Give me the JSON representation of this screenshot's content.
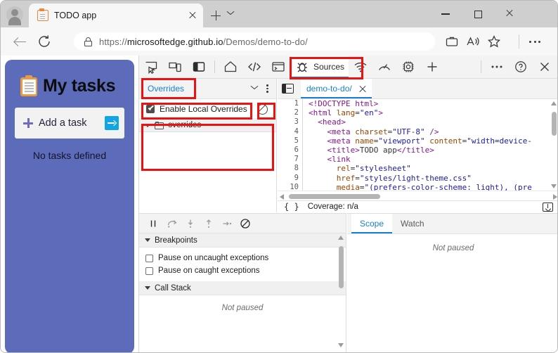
{
  "browser": {
    "tab": {
      "title": "TODO app",
      "favicon": "clipboard-icon"
    },
    "window_controls": {
      "minimize": "Minimize",
      "maximize": "Maximize",
      "close": "Close"
    },
    "new_tab": "New tab",
    "tab_list": "Tab actions menu",
    "nav": {
      "back": "Back",
      "reload": "Refresh"
    },
    "address": {
      "scheme": "https://",
      "host": "microsoftedge.github.io",
      "path": "/Demos/demo-to-do/",
      "lock": "site-information-lock-icon"
    },
    "toolbar_icons": {
      "collections": "collections-icon",
      "read_aloud": "read-aloud-icon",
      "favorites": "favorites-star-icon",
      "settings": "settings-and-more-icon"
    }
  },
  "page": {
    "title": "My tasks",
    "clipboard_emoji": "clipboard-icon",
    "add_task_placeholder": "Add a task",
    "submit_label": "submit-arrow-icon",
    "empty_state": "No tasks defined"
  },
  "devtools": {
    "toolbar_left": [
      {
        "name": "inspect-element-icon",
        "label": ""
      },
      {
        "name": "device-emulation-icon",
        "label": ""
      },
      {
        "name": "dock-side-icon",
        "label": ""
      }
    ],
    "tabs": [
      {
        "name": "welcome",
        "label": "",
        "icon": "home-icon",
        "selected": false
      },
      {
        "name": "elements",
        "label": "",
        "icon": "code-icon",
        "selected": false
      },
      {
        "name": "console",
        "label": "",
        "icon": "console-icon",
        "selected": false
      },
      {
        "name": "sources",
        "label": "Sources",
        "icon": "bug-icon",
        "selected": true
      },
      {
        "name": "network",
        "label": "",
        "icon": "wifi-icon",
        "selected": false
      },
      {
        "name": "performance",
        "label": "",
        "icon": "gauge-icon",
        "selected": false
      },
      {
        "name": "memory",
        "label": "",
        "icon": "chip-icon",
        "selected": false
      },
      {
        "name": "more-tools",
        "label": "",
        "icon": "plus-icon",
        "selected": false
      }
    ],
    "toolbar_right": [
      {
        "name": "customize-devtools",
        "icon": "kebab-icon"
      },
      {
        "name": "help",
        "icon": "question-mark-icon"
      },
      {
        "name": "close-devtools",
        "icon": "close-icon"
      }
    ],
    "navigator": {
      "tab_label": "Overrides",
      "more_tabs_icon": "chevron-down-icon",
      "kebab_icon": "kebab-icon",
      "enable_local_overrides": "Enable Local Overrides",
      "enable_checked": true,
      "clear_overrides_icon": "clear-configuration-icon",
      "tree_root": "overrides"
    },
    "editor": {
      "drawer_icon": "show-navigator-icon",
      "tab_label": "demo-to-do/",
      "close_icon": "close-icon",
      "code_lines": [
        {
          "n": 1,
          "tokens": [
            {
              "t": "tg",
              "s": "<!DOCTYPE html>"
            }
          ]
        },
        {
          "n": 2,
          "tokens": [
            {
              "t": "tg",
              "s": "<html "
            },
            {
              "t": "at",
              "s": "lang"
            },
            {
              "t": "pl",
              "s": "="
            },
            {
              "t": "va",
              "s": "\"en\""
            },
            {
              "t": "tg",
              "s": ">"
            }
          ]
        },
        {
          "n": 3,
          "tokens": [
            {
              "t": "pl",
              "s": "  "
            },
            {
              "t": "tg",
              "s": "<head>"
            }
          ]
        },
        {
          "n": 4,
          "tokens": [
            {
              "t": "pl",
              "s": "    "
            },
            {
              "t": "tg",
              "s": "<meta "
            },
            {
              "t": "at",
              "s": "charset"
            },
            {
              "t": "pl",
              "s": "="
            },
            {
              "t": "va",
              "s": "\"UTF-8\""
            },
            {
              "t": "tg",
              "s": " />"
            }
          ]
        },
        {
          "n": 5,
          "tokens": [
            {
              "t": "pl",
              "s": "    "
            },
            {
              "t": "tg",
              "s": "<meta "
            },
            {
              "t": "at",
              "s": "name"
            },
            {
              "t": "pl",
              "s": "="
            },
            {
              "t": "va",
              "s": "\"viewport\""
            },
            {
              "t": "at",
              "s": " content"
            },
            {
              "t": "pl",
              "s": "="
            },
            {
              "t": "va",
              "s": "\"width=device-"
            }
          ]
        },
        {
          "n": 6,
          "tokens": [
            {
              "t": "pl",
              "s": "    "
            },
            {
              "t": "tg",
              "s": "<title>"
            },
            {
              "t": "pl",
              "s": "TODO app"
            },
            {
              "t": "tg",
              "s": "</title>"
            }
          ]
        },
        {
          "n": 7,
          "tokens": [
            {
              "t": "pl",
              "s": "    "
            },
            {
              "t": "tg",
              "s": "<link"
            }
          ]
        },
        {
          "n": 8,
          "tokens": [
            {
              "t": "pl",
              "s": "      "
            },
            {
              "t": "at",
              "s": "rel"
            },
            {
              "t": "pl",
              "s": "="
            },
            {
              "t": "va",
              "s": "\"stylesheet\""
            }
          ]
        },
        {
          "n": 9,
          "tokens": [
            {
              "t": "pl",
              "s": "      "
            },
            {
              "t": "at",
              "s": "href"
            },
            {
              "t": "pl",
              "s": "="
            },
            {
              "t": "va",
              "s": "\"styles/light-theme.css\""
            }
          ]
        },
        {
          "n": 10,
          "tokens": [
            {
              "t": "pl",
              "s": "      "
            },
            {
              "t": "at",
              "s": "media"
            },
            {
              "t": "pl",
              "s": "="
            },
            {
              "t": "va",
              "s": "\"(prefers-color-scheme: light), (pre"
            }
          ]
        }
      ],
      "pretty_print": "{ }",
      "coverage": "Coverage: n/a",
      "export_icon": "export-icon"
    },
    "debugger": {
      "controls": [
        {
          "name": "pause-script-execution",
          "icon": "pause-icon"
        },
        {
          "name": "step-over",
          "icon": "step-over-icon"
        },
        {
          "name": "step-into",
          "icon": "step-into-icon"
        },
        {
          "name": "step-out",
          "icon": "step-out-icon"
        },
        {
          "name": "step",
          "icon": "step-icon"
        },
        {
          "name": "deactivate-breakpoints",
          "icon": "deactivate-breakpoints-icon"
        }
      ],
      "breakpoints_header": "Breakpoints",
      "breakpoint_options": [
        {
          "label": "Pause on uncaught exceptions",
          "checked": false
        },
        {
          "label": "Pause on caught exceptions",
          "checked": false
        }
      ],
      "call_stack_header": "Call Stack",
      "call_stack_empty": "Not paused"
    },
    "scope_panel": {
      "tabs": [
        {
          "label": "Scope",
          "selected": true
        },
        {
          "label": "Watch",
          "selected": false
        }
      ],
      "empty": "Not paused"
    }
  },
  "annotations": {
    "color": "#ee1111",
    "boxes": [
      {
        "name": "overrides-tab-highlight"
      },
      {
        "name": "enable-local-overrides-highlight"
      },
      {
        "name": "clear-overrides-highlight"
      },
      {
        "name": "overrides-tree-highlight"
      },
      {
        "name": "sources-tab-highlight"
      }
    ]
  }
}
